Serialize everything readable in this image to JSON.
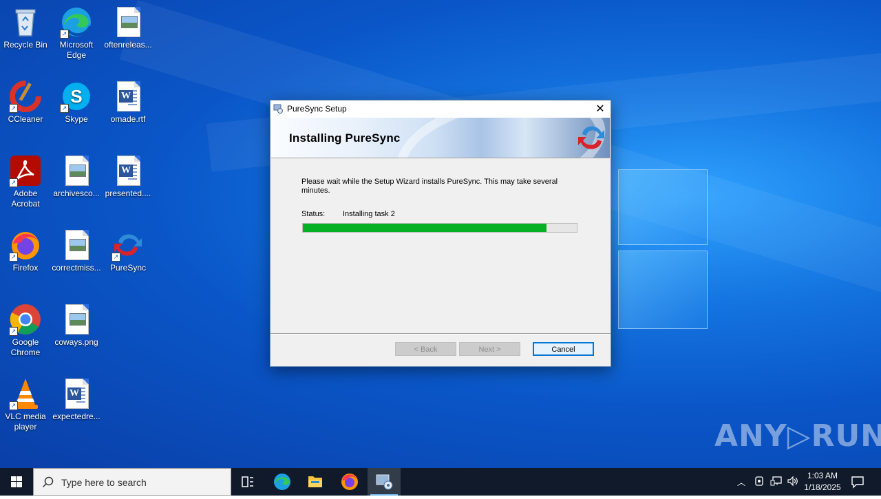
{
  "desktop": {
    "icons": [
      {
        "label": "Recycle Bin",
        "icon": "recycle-bin-icon"
      },
      {
        "label": "Microsoft Edge",
        "icon": "edge-icon"
      },
      {
        "label": "oftenreleas...",
        "icon": "image-file-icon"
      },
      {
        "label": "CCleaner",
        "icon": "ccleaner-icon"
      },
      {
        "label": "Skype",
        "icon": "skype-icon"
      },
      {
        "label": "omade.rtf",
        "icon": "word-document-icon"
      },
      {
        "label": "Adobe Acrobat",
        "icon": "acrobat-icon"
      },
      {
        "label": "archivesco...",
        "icon": "image-file-icon"
      },
      {
        "label": "presented....",
        "icon": "word-document-icon"
      },
      {
        "label": "Firefox",
        "icon": "firefox-icon"
      },
      {
        "label": "correctmiss...",
        "icon": "image-file-icon"
      },
      {
        "label": "PureSync",
        "icon": "puresync-icon"
      },
      {
        "label": "Google Chrome",
        "icon": "chrome-icon"
      },
      {
        "label": "coways.png",
        "icon": "image-file-icon"
      },
      {
        "label": "VLC media player",
        "icon": "vlc-icon"
      },
      {
        "label": "expectedre...",
        "icon": "word-document-icon"
      }
    ]
  },
  "dialog": {
    "title": "PureSync Setup",
    "close_glyph": "✕",
    "banner_title": "Installing PureSync",
    "body_text": "Please wait while the Setup Wizard installs PureSync.  This may take several minutes.",
    "status_label": "Status:",
    "status_value": "Installing task 2",
    "progress_fraction": 0.89,
    "progress_color": "#06b025",
    "buttons": {
      "back": "< Back",
      "next": "Next >",
      "cancel": "Cancel"
    }
  },
  "taskbar": {
    "search_placeholder": "Type here to search",
    "apps": [
      "task-view-icon",
      "edge-icon",
      "file-explorer-icon",
      "firefox-icon",
      "setup-installer-icon"
    ],
    "clock_time": "1:03 AM",
    "clock_date": "1/18/2025"
  },
  "watermark": "ANY▷RUN"
}
